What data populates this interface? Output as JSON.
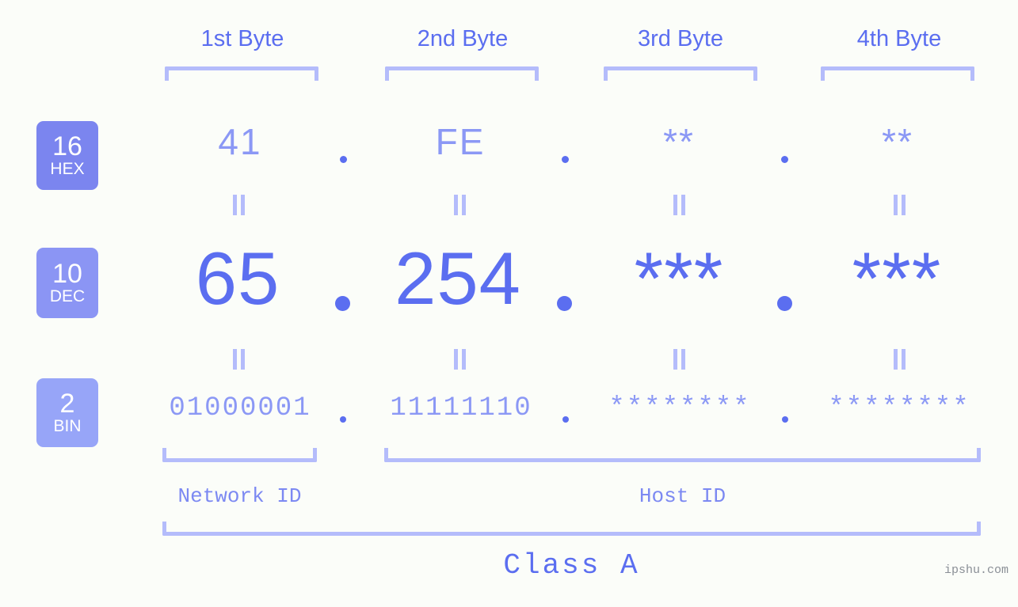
{
  "page": {
    "background_color": "#fbfdf9",
    "accent_color": "#5b6ef0",
    "accent_light_color": "#8b98f5",
    "bracket_color": "#b4bcfb",
    "watermark": "ipshu.com"
  },
  "byte_headers": [
    {
      "label": "1st Byte"
    },
    {
      "label": "2nd Byte"
    },
    {
      "label": "3rd Byte"
    },
    {
      "label": "4th Byte"
    }
  ],
  "radix_badges": [
    {
      "number": "16",
      "name": "HEX",
      "color": "#7b85ef"
    },
    {
      "number": "10",
      "name": "DEC",
      "color": "#8b95f4"
    },
    {
      "number": "2",
      "name": "BIN",
      "color": "#97a5f8"
    }
  ],
  "rows": {
    "hex": {
      "radix": "16",
      "radix_name": "HEX",
      "values": [
        "41",
        "FE",
        "**",
        "**"
      ],
      "separator": "."
    },
    "dec": {
      "radix": "10",
      "radix_name": "DEC",
      "values": [
        "65",
        "254",
        "***",
        "***"
      ],
      "separator": "."
    },
    "bin": {
      "radix": "2",
      "radix_name": "BIN",
      "values": [
        "01000001",
        "11111110",
        "********",
        "********"
      ],
      "separator": "."
    }
  },
  "equality_marks": {
    "symbol": "=",
    "count_per_row": 4
  },
  "footer": {
    "network_id_label": "Network ID",
    "host_id_label": "Host ID",
    "class_label": "Class A"
  }
}
